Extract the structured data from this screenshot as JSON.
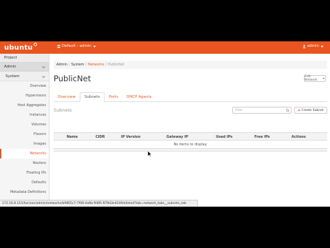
{
  "header": {
    "brand": "ubuntu",
    "project_selector": "Default - admin",
    "user_menu": "admin"
  },
  "sidebar": {
    "sections": [
      "Project",
      "Admin"
    ],
    "subsection": "System",
    "items": [
      {
        "label": "Overview",
        "active": false
      },
      {
        "label": "Hypervisors",
        "active": false
      },
      {
        "label": "Host Aggregates",
        "active": false
      },
      {
        "label": "Instances",
        "active": false
      },
      {
        "label": "Volumes",
        "active": false
      },
      {
        "label": "Flavors",
        "active": false
      },
      {
        "label": "Images",
        "active": false
      },
      {
        "label": "Networks",
        "active": true
      },
      {
        "label": "Routers",
        "active": false
      },
      {
        "label": "Floating IPs",
        "active": false
      },
      {
        "label": "Defaults",
        "active": false
      },
      {
        "label": "Metadata Definitions",
        "active": false
      }
    ]
  },
  "breadcrumb": {
    "items": [
      "Admin",
      "System",
      "Networks",
      "PublicNet"
    ]
  },
  "page": {
    "title": "PublicNet",
    "edit_button": "Edit Network"
  },
  "tabs": [
    {
      "label": "Overview",
      "active": false
    },
    {
      "label": "Subnets",
      "active": true
    },
    {
      "label": "Ports",
      "active": false
    },
    {
      "label": "DHCP Agents",
      "active": false
    }
  ],
  "subnets": {
    "heading": "Subnets",
    "filter_placeholder": "Filter",
    "create_button": "Create Subnet",
    "columns": [
      "Name",
      "CIDR",
      "IP Version",
      "Gateway IP",
      "Used IPs",
      "Free IPs",
      "Actions"
    ],
    "empty_message": "No items to display."
  },
  "status_url": "172.16.8.115/horizon/admin/networks/b9865c7-7f08-4a6b-9485-979d3e4249d/detail?tab=network_tabs__subnets_tab",
  "colors": {
    "accent": "#e95420"
  }
}
